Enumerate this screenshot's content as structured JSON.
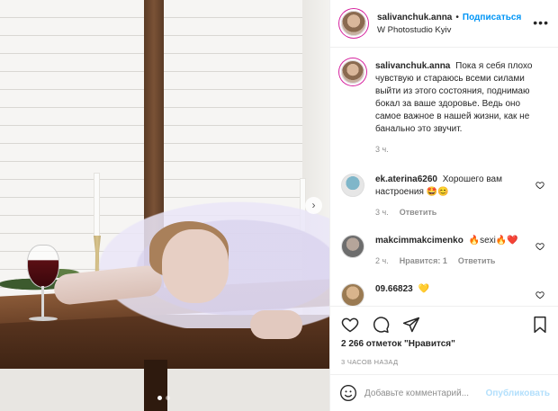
{
  "post": {
    "username": "salivanchuk.anna",
    "separator": "•",
    "follow_label": "Подписаться",
    "location": "W Photostudio Kyiv",
    "more_label": "•••",
    "caption": "Пока я себя плохо чувствую и стараюсь всеми силами выйти из этого состояния, поднимаю бокал за ваше здоровье. Ведь оно самое важное в нашей жизни, как не банально это звучит.",
    "caption_time": "3 ч.",
    "likes": "2 266 отметок \"Нравится\"",
    "posted_ago": "3 ЧАСОВ НАЗАД",
    "carousel_next": "›",
    "carousel_dots": 2,
    "carousel_active": 0
  },
  "comments": [
    {
      "username": "ek.aterina6260",
      "text": "Хорошего вам настроения 🤩😊",
      "time": "3 ч.",
      "reply": "Ответить",
      "likes_label": ""
    },
    {
      "username": "makcimmakcimenko",
      "text": "🔥sexi🔥❤️",
      "time": "2 ч.",
      "likes_label": "Нравится: 1",
      "reply": "Ответить"
    },
    {
      "username": "09.66823",
      "text": "💛",
      "time": "",
      "likes_label": "",
      "reply": ""
    }
  ],
  "comment_input": {
    "placeholder": "Добавьте комментарий...",
    "publish_label": "Опубликовать",
    "emoji_icon": "smile-icon"
  },
  "icons": {
    "like": "heart-icon",
    "comment": "comment-icon",
    "share": "send-icon",
    "save": "bookmark-icon"
  },
  "colors": {
    "follow": "#0095f6",
    "publish_disabled": "#b2dffc",
    "muted": "#8e8e8e",
    "text": "#262626"
  }
}
